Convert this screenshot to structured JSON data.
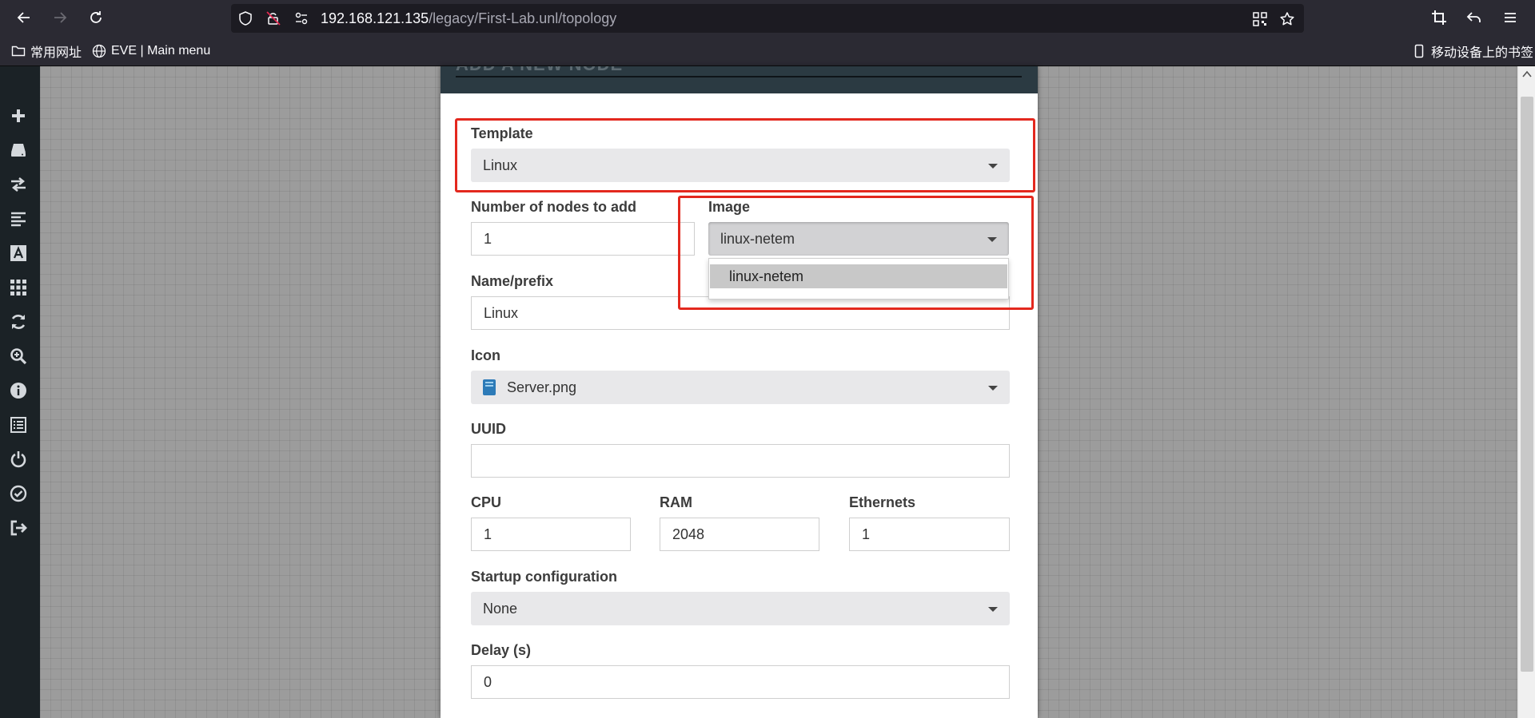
{
  "browser": {
    "url_host": "192.168.121.135",
    "url_path": "/legacy/First-Lab.unl/topology",
    "bookmarks": [
      {
        "label": "常用网址",
        "icon": "folder-icon"
      },
      {
        "label": "EVE | Main menu",
        "icon": "globe-icon"
      }
    ],
    "mobile_bookmarks": "移动设备上的书签"
  },
  "sidebar": {
    "icons": [
      "plus-icon",
      "drive-icon",
      "exchange-icon",
      "align-left-icon",
      "text-icon",
      "grid-icon",
      "refresh-icon",
      "zoom-in-icon",
      "info-icon",
      "list-icon",
      "power-icon",
      "check-circle-icon",
      "sign-out-icon"
    ]
  },
  "modal": {
    "title": "ADD A NEW NODE",
    "template": {
      "label": "Template",
      "value": "Linux"
    },
    "nodes": {
      "label": "Number of nodes to add",
      "value": "1"
    },
    "image": {
      "label": "Image",
      "value": "linux-netem",
      "options": [
        "linux-netem"
      ]
    },
    "name": {
      "label": "Name/prefix",
      "value": "Linux"
    },
    "icon": {
      "label": "Icon",
      "value": "Server.png"
    },
    "uuid": {
      "label": "UUID",
      "value": ""
    },
    "cpu": {
      "label": "CPU",
      "value": "1"
    },
    "ram": {
      "label": "RAM",
      "value": "2048"
    },
    "ethernets": {
      "label": "Ethernets",
      "value": "1"
    },
    "startup": {
      "label": "Startup configuration",
      "value": "None"
    },
    "delay": {
      "label": "Delay (s)",
      "value": "0"
    }
  },
  "colors": {
    "highlight": "#e3281e",
    "modal_header": "#2b3a42",
    "sidebar": "#1b2226",
    "canvas": "#9c9c9c"
  }
}
